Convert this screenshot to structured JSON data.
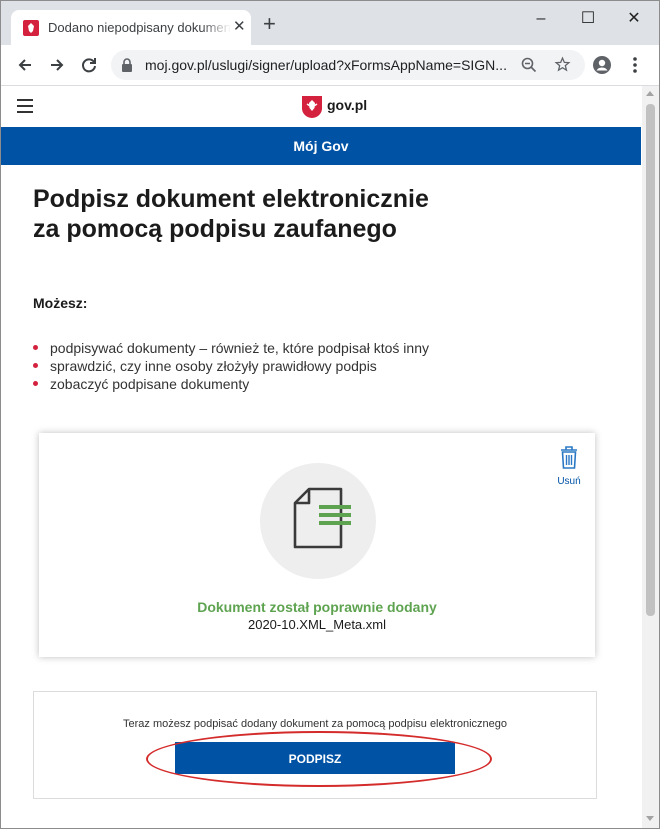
{
  "browser": {
    "tab_title": "Dodano niepodpisany dokument",
    "tab_close": "✕",
    "new_tab": "+",
    "window_controls": {
      "minimize": "–",
      "maximize": "☐",
      "close": "✕"
    },
    "url": "moj.gov.pl/uslugi/signer/upload?xFormsAppName=SIGN...",
    "icons": [
      "back-icon",
      "forward-icon",
      "reload-icon",
      "lock-icon",
      "zoom-icon",
      "star-icon",
      "profile-icon",
      "menu-icon"
    ]
  },
  "header": {
    "logo_text": "gov.pl",
    "banner": "Mój Gov"
  },
  "main": {
    "title_line1": "Podpisz dokument elektronicznie",
    "title_line2": "za pomocą podpisu zaufanego",
    "can_label": "Możesz:",
    "bullets": [
      "podpisywać dokumenty – również te, które podpisał ktoś inny",
      "sprawdzić, czy inne osoby złożyły prawidłowy podpis",
      "zobaczyć podpisane dokumenty"
    ]
  },
  "document_card": {
    "delete_label": "Usuń",
    "status": "Dokument został poprawnie dodany",
    "filename": "2020-10.XML_Meta.xml"
  },
  "sign": {
    "info": "Teraz możesz podpisać dodany dokument za pomocą podpisu elektronicznego",
    "button": "PODPISZ"
  },
  "colors": {
    "brand_blue": "#0052a5",
    "success_green": "#5ea350",
    "bullet_red": "#d4213d",
    "annotation_red": "#d42b2b"
  }
}
